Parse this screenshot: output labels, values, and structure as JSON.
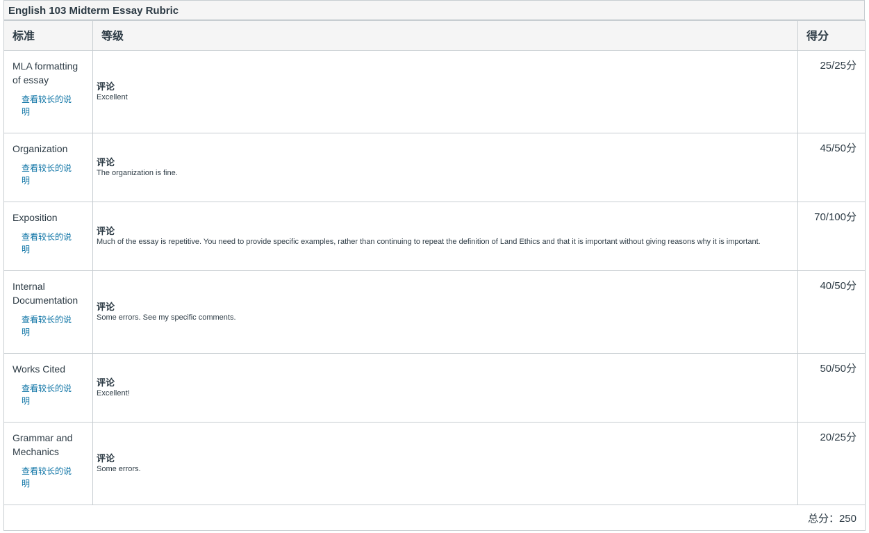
{
  "rubric": {
    "title": "English 103 Midterm Essay Rubric",
    "headers": {
      "criteria": "标准",
      "ratings": "等级",
      "points": "得分"
    },
    "long_description_label": "查看较长的说明",
    "comment_label": "评论",
    "criteria": [
      {
        "name": "MLA formatting of essay",
        "comment": "Excellent",
        "score": "25/25分"
      },
      {
        "name": "Organization",
        "comment": "The organization is fine.",
        "score": "45/50分"
      },
      {
        "name": "Exposition",
        "comment": "Much of the essay is repetitive. You need to provide specific examples, rather than continuing to repeat the definition of Land Ethics and that it is important without giving reasons why it is important.",
        "score": "70/100分"
      },
      {
        "name": "Internal Documentation",
        "comment": "Some errors. See my specific comments.",
        "score": "40/50分"
      },
      {
        "name": "Works Cited",
        "comment": "Excellent!",
        "score": "50/50分"
      },
      {
        "name": "Grammar and Mechanics",
        "comment": "Some errors.",
        "score": "20/25分"
      }
    ],
    "total": "总分：250"
  }
}
